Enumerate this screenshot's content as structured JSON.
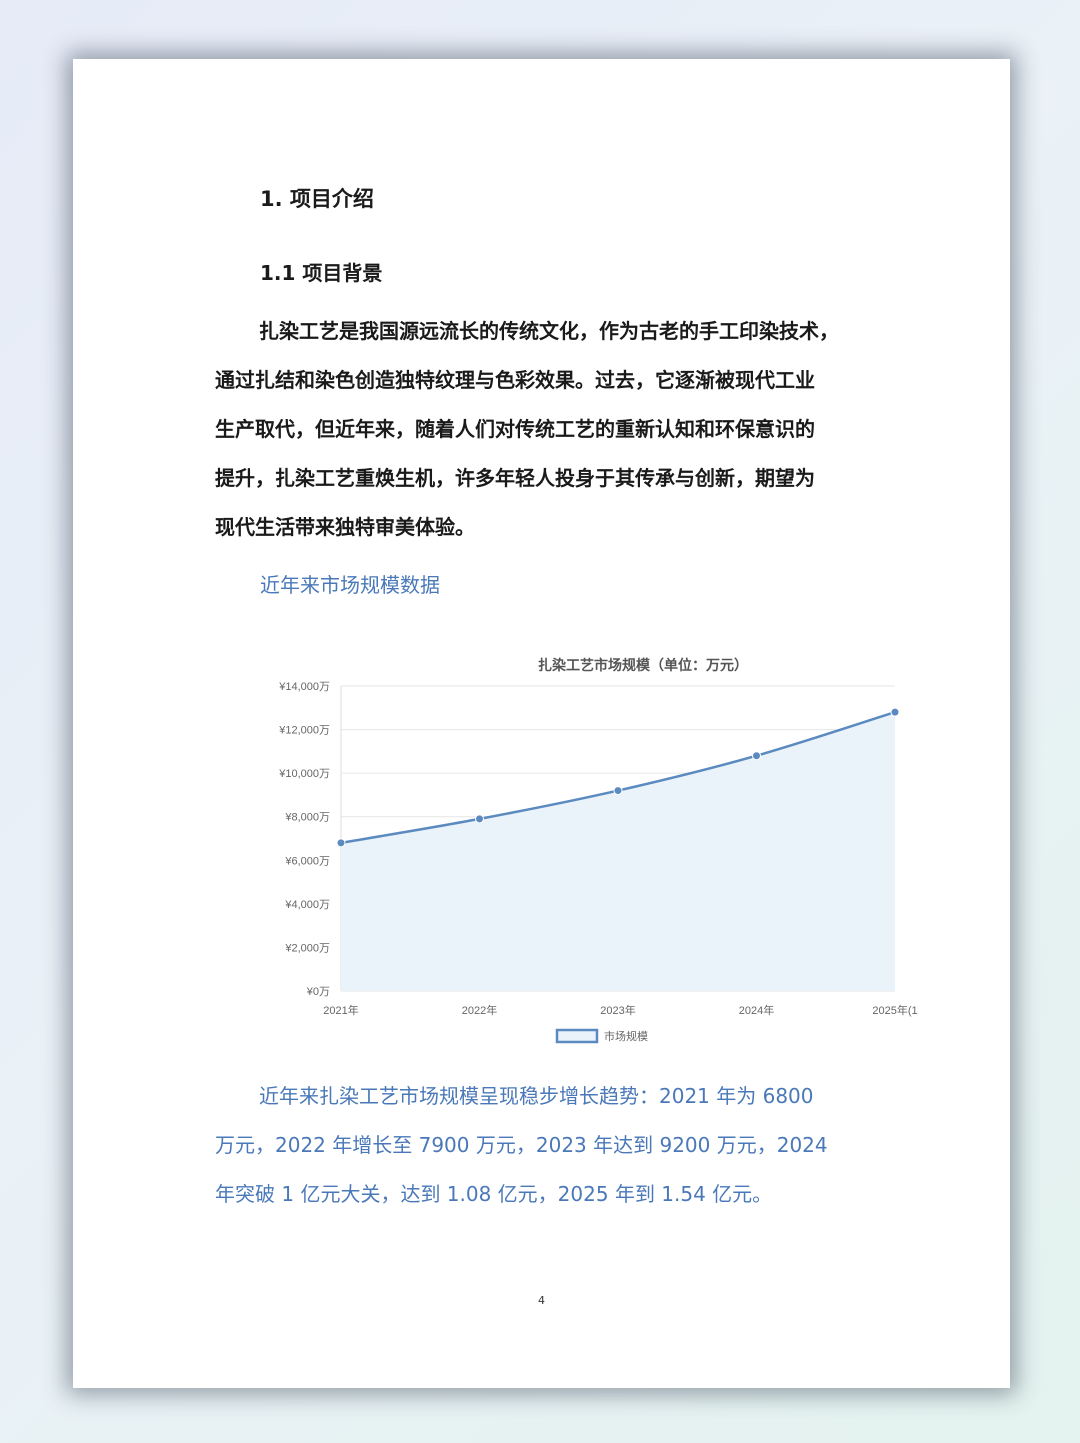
{
  "document": {
    "section_title": "1. 项目介绍",
    "subsection_title": "1.1 项目背景",
    "paragraph_lines": [
      "扎染工艺是我国源远流长的传统文化，作为古老的手工印染技术，",
      "通过扎结和染色创造独特纹理与色彩效果。过去，它逐渐被现代工业",
      "生产取代，但近年来，随着人们对传统工艺的重新认知和环保意识的",
      "提升，扎染工艺重焕生机，许多年轻人投身于其传承与创新，期望为",
      "现代生活带来独特审美体验。"
    ],
    "chart_caption": "近年来市场规模数据",
    "summary_lines": [
      "近年来扎染工艺市场规模呈现稳步增长趋势：2021 年为 6800",
      "万元，2022 年增长至 7900 万元，2023 年达到 9200 万元，2024",
      "年突破 1 亿元大关，达到 1.08 亿元，2025 年到 1.54 亿元。"
    ],
    "page_number": "4"
  },
  "colors": {
    "accent_text": "#4a78b8",
    "line": "#5b8ac0",
    "area_fill": "#eaf2fa",
    "grid": "#e6e6e6"
  },
  "chart_data": {
    "type": "area",
    "title": "扎染工艺市场规模（单位：万元）",
    "xlabel": "",
    "ylabel": "",
    "categories": [
      "2021年",
      "2022年",
      "2023年",
      "2024年",
      "2025年(1"
    ],
    "series": [
      {
        "name": "市场规模",
        "values": [
          6800,
          7900,
          9200,
          10800,
          12800
        ]
      }
    ],
    "y_ticks": [
      0,
      2000,
      4000,
      6000,
      8000,
      10000,
      12000,
      14000
    ],
    "y_tick_labels": [
      "¥0万",
      "¥2,000万",
      "¥4,000万",
      "¥6,000万",
      "¥8,000万",
      "¥10,000万",
      "¥12,000万",
      "¥14,000万"
    ],
    "ylim": [
      0,
      14000
    ],
    "grid": true,
    "legend_position": "bottom"
  }
}
